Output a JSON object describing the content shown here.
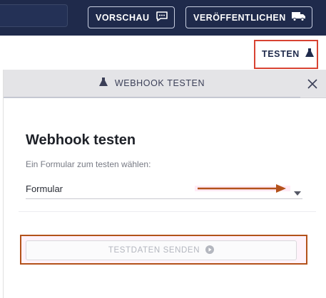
{
  "topbar": {
    "preview_label": "VORSCHAU",
    "publish_label": "VERÖFFENTLICHEN",
    "preview_icon": "comment-preview-icon",
    "publish_icon": "truck-icon",
    "background_color": "#1f2a4b"
  },
  "test_link": {
    "label": "TESTEN",
    "icon": "flask-icon"
  },
  "panel": {
    "tab_label": "WEBHOOK TESTEN",
    "tab_icon": "flask-icon",
    "close_icon": "close-icon",
    "title": "Webhook testen",
    "form_label": "Ein Formular zum testen wählen:",
    "select_value": "Formular",
    "send_button_label": "TESTDATEN SENDEN",
    "send_button_icon": "play-circle-icon"
  },
  "annotations": {
    "highlight_color": "#d84332",
    "arrow_color": "#b3511a"
  }
}
